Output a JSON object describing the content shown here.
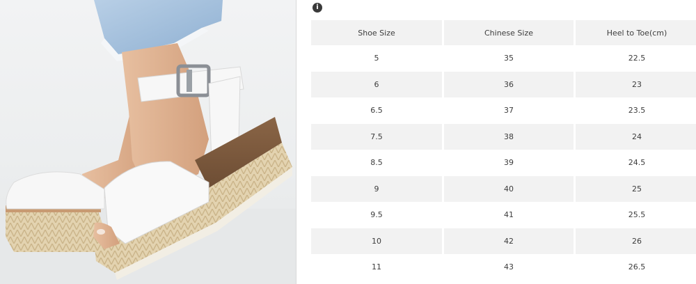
{
  "size_chart": {
    "columns": [
      "Shoe Size",
      "Chinese Size",
      "Heel to Toe(cm)"
    ],
    "rows": [
      [
        "5",
        "35",
        "22.5"
      ],
      [
        "6",
        "36",
        "23"
      ],
      [
        "6.5",
        "37",
        "23.5"
      ],
      [
        "7.5",
        "38",
        "24"
      ],
      [
        "8.5",
        "39",
        "24.5"
      ],
      [
        "9",
        "40",
        "25"
      ],
      [
        "9.5",
        "41",
        "25.5"
      ],
      [
        "10",
        "42",
        "26"
      ],
      [
        "11",
        "43",
        "26.5"
      ]
    ]
  },
  "info_badge": {
    "icon": "info-icon"
  }
}
